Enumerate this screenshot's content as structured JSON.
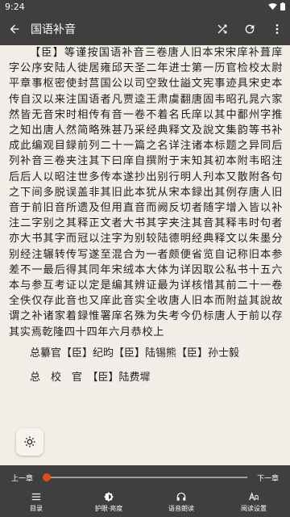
{
  "status_bar": {
    "time": "9:24"
  },
  "app_bar": {
    "title": "国语补音"
  },
  "content": {
    "paragraph": "【臣】等谨按国语补音三卷唐人旧本宋宋庠补葺庠字公序安陆人徙居雍邱天圣二年进士第一历官检校太尉平章事枢密使封莒国公以司空致仕謚文宪事迹具宋史本传自汉以来注国语者凡贾逵王肃虞翻唐固韦昭孔晁六家然皆无音宋时相传有音一卷不着名氏庠以其中鄱州字推之知出唐人然简略殊甚乃采经典释文及說文集韵等书补成此编观目録前列二十一篇之名详注诸本标题之异同后列补音三卷夹注其下曰庠自撰附于末知其初本附韦昭注后后人以昭注世多传本遂抄出别行明人刋本又散附各句之下间多脱误盖非其旧此本犹从宋本録出其例存唐人旧音于前旧音所遗及但用直音而阙反切者随字增入皆以补注二字别之其释正文者大书其字夹注其音其释韦时句者亦大书其字而冠以注字为别较陆德明经典释文以朱墨分别经注辗转传写遂至混合为一者颇便省览自记称旧本参差不一最后得其同年宋绒本大体为详因取公私书十五六本与参互考证以定是编其辨证最为详核惜其前二十一卷全佚仅存此音也又庠此音实全收唐人旧本而附益其說故谓之补诸家着録惟署庠名殊为失考今仍标唐人于前以存其实焉乾隆四十四年六月恭校上",
    "credits": [
      "总纂官【臣】纪昀【臣】陆锡熊【臣】孙士毅",
      "总　校　官　【臣】陆费墀"
    ]
  },
  "chapter_nav": {
    "prev_label": "上一章",
    "next_label": "下一章",
    "progress": 0.0
  },
  "bottom_menu": [
    {
      "label": "目录",
      "icon": "list-icon"
    },
    {
      "label": "护眼·亮度",
      "icon": "brightness-icon"
    },
    {
      "label": "语音朗读",
      "icon": "headphones-icon"
    },
    {
      "label": "阅读设置",
      "icon": "text-settings-icon"
    }
  ],
  "colors": {
    "bar": "#3F3F3F",
    "page": "#F2EEE7",
    "accent": "#E64A19"
  }
}
